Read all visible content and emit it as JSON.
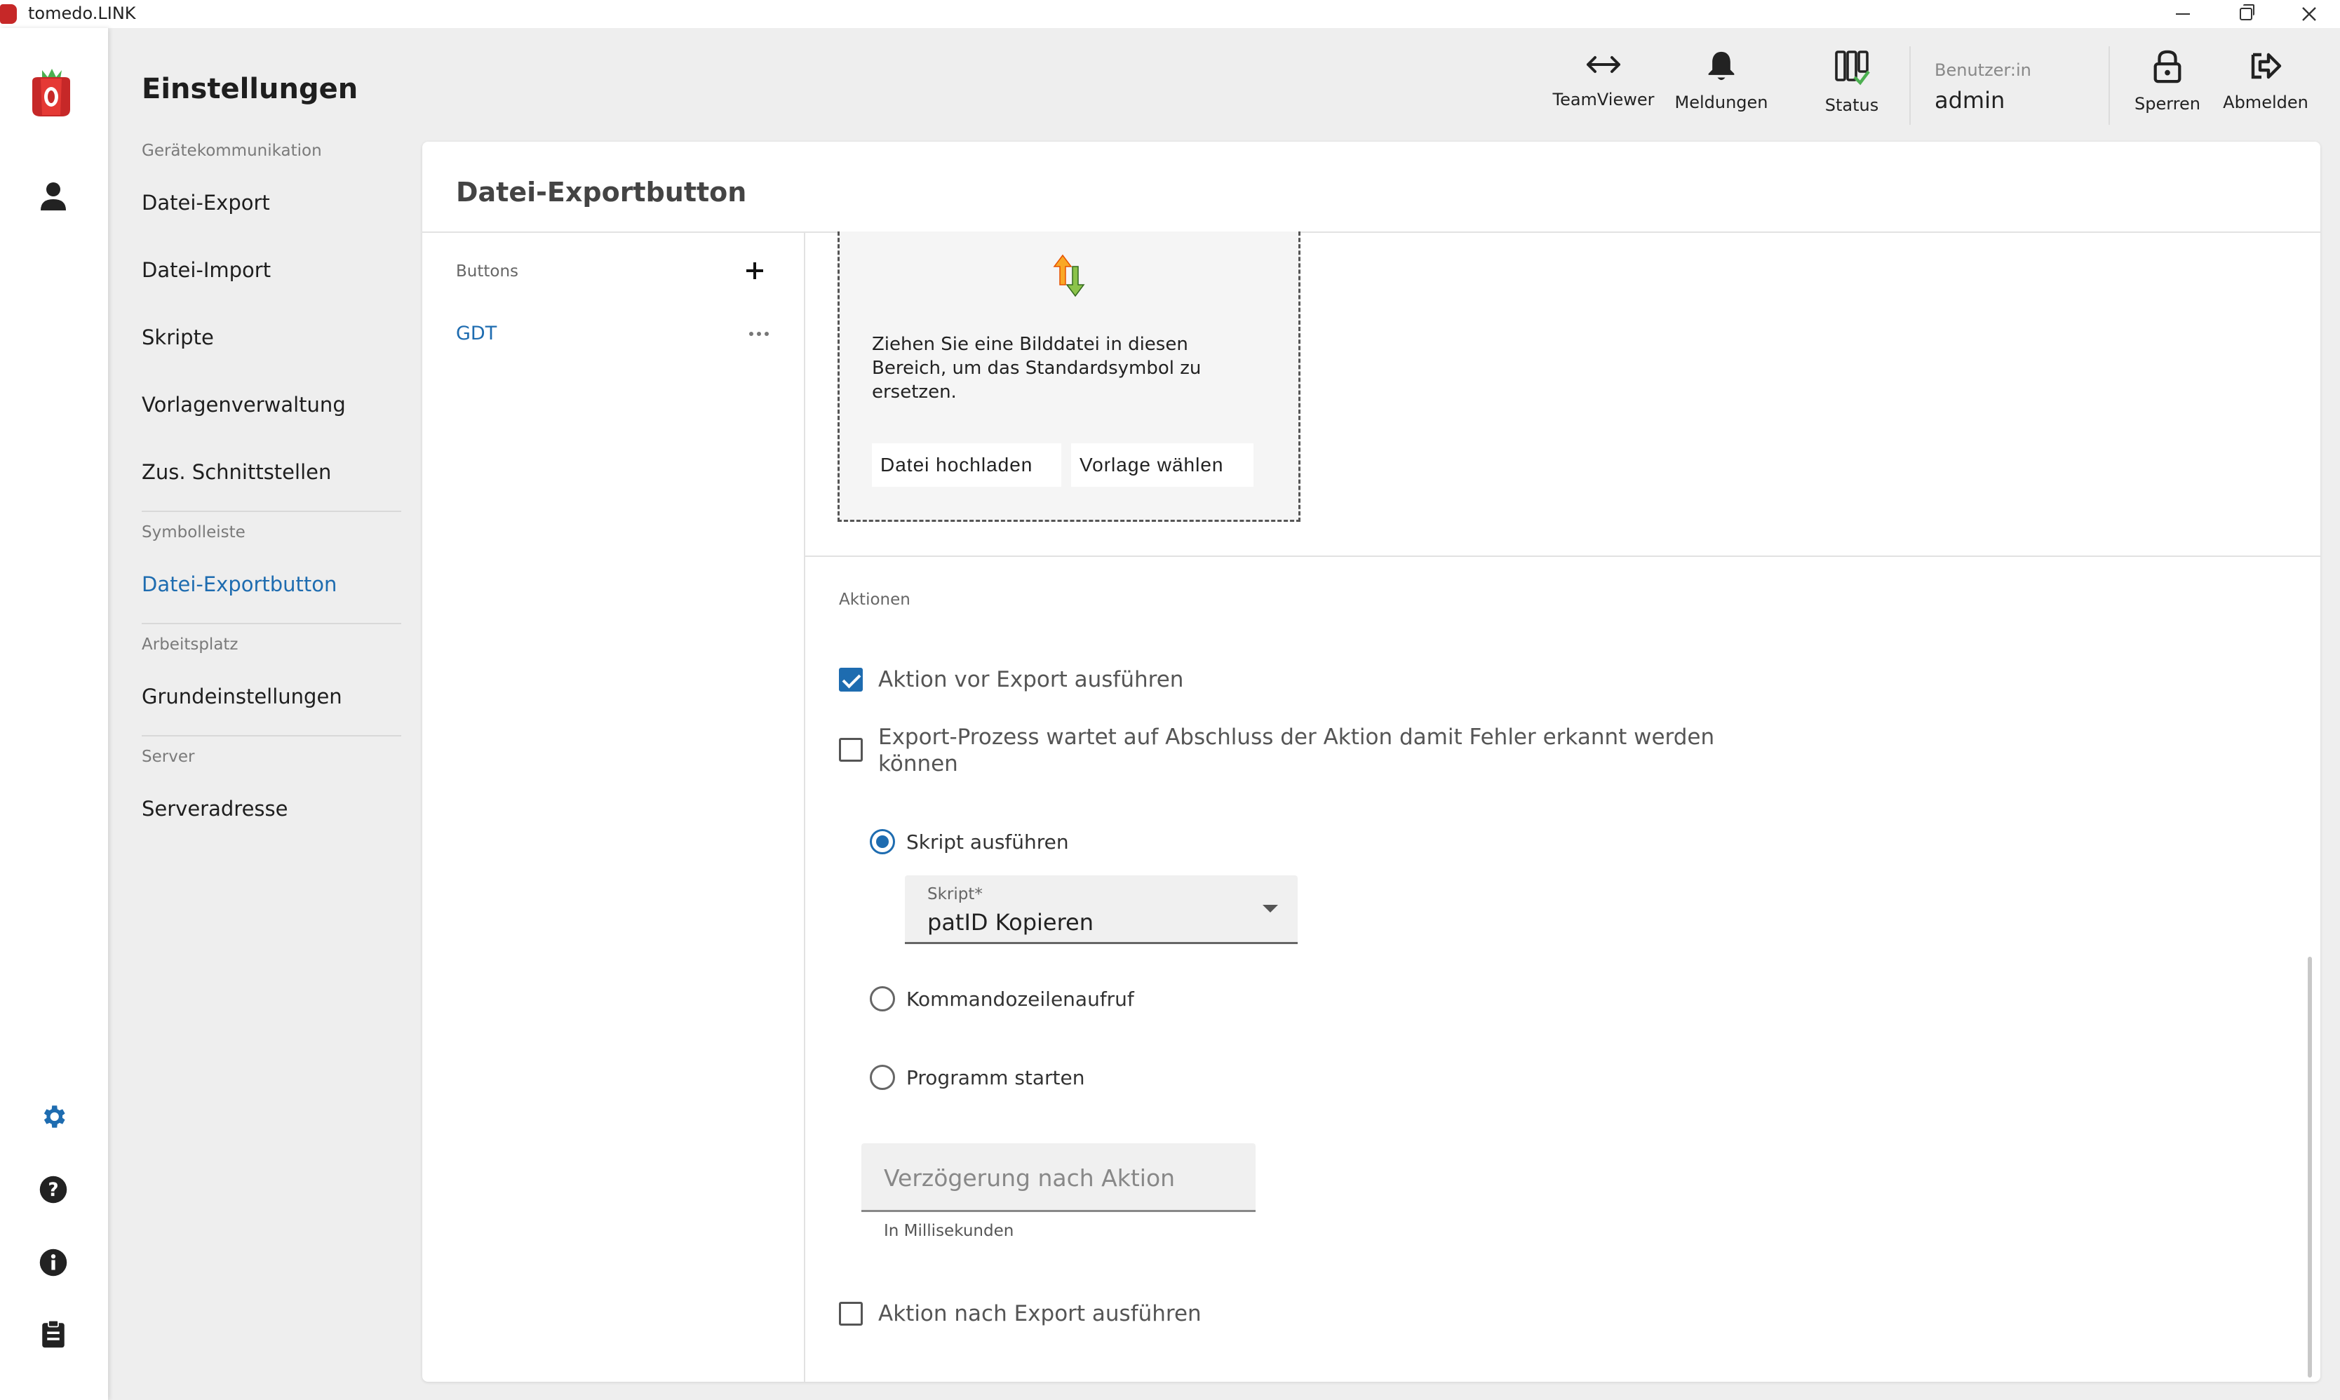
{
  "window": {
    "title": "tomedo.LINK"
  },
  "settings": {
    "title": "Einstellungen",
    "sections": [
      {
        "label": "Gerätekommunikation",
        "items": [
          "Datei-Export",
          "Datei-Import",
          "Skripte",
          "Vorlagenverwaltung",
          "Zus. Schnittstellen"
        ]
      },
      {
        "label": "Symbolleiste",
        "items": [
          "Datei-Exportbutton"
        ]
      },
      {
        "label": "Arbeitsplatz",
        "items": [
          "Grundeinstellungen"
        ]
      },
      {
        "label": "Server",
        "items": [
          "Serveradresse"
        ]
      }
    ],
    "active_item": "Datei-Exportbutton"
  },
  "toolbar": {
    "teamviewer": "TeamViewer",
    "notifications": "Meldungen",
    "status": "Status",
    "user_label": "Benutzer:in",
    "user_name": "admin",
    "lock": "Sperren",
    "logout": "Abmelden"
  },
  "main": {
    "title": "Datei-Exportbutton",
    "buttons_label": "Buttons",
    "buttons": [
      "GDT"
    ],
    "dropzone": {
      "text": "Ziehen Sie eine Bilddatei in diesen Bereich, um das Standardsymbol zu ersetzen.",
      "upload_label": "Datei hochladen",
      "template_label": "Vorlage wählen"
    },
    "actions": {
      "label": "Aktionen",
      "pre_export_checkbox": {
        "label": "Aktion vor Export ausführen",
        "checked": true
      },
      "wait_checkbox": {
        "label": "Export-Prozess wartet auf Abschluss der Aktion damit Fehler erkannt werden können",
        "checked": false
      },
      "radio_options": [
        {
          "label": "Skript ausführen",
          "selected": true
        },
        {
          "label": "Kommandozeilenaufruf",
          "selected": false
        },
        {
          "label": "Programm starten",
          "selected": false
        }
      ],
      "script_select": {
        "label": "Skript*",
        "value": "patID Kopieren"
      },
      "delay_field": {
        "placeholder": "Verzögerung nach Aktion",
        "helper": "In Millisekunden"
      },
      "post_export_checkbox": {
        "label": "Aktion nach Export ausführen",
        "checked": false
      }
    }
  },
  "colors": {
    "accent": "#1e6cb0",
    "brand_red": "#c62828"
  }
}
